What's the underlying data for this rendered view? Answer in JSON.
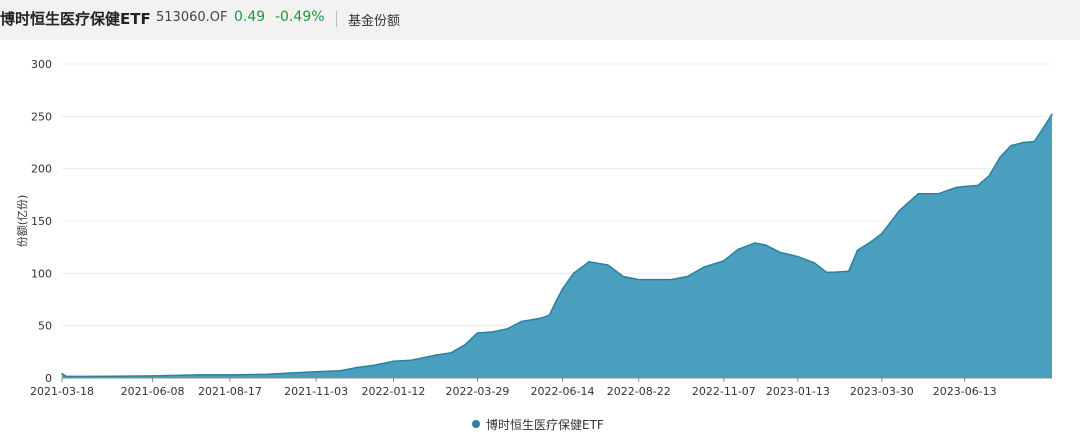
{
  "header": {
    "fund_name": "博时恒生医疗保健ETF",
    "fund_code": "513060.OF",
    "price": "0.49",
    "change": "-0.49%",
    "metric_label": "基金份额"
  },
  "colors": {
    "area": "#4a9fbf",
    "line": "#2e7f9f",
    "legend_dot": "#2e7f9f",
    "grid": "#ececec",
    "up_down": "#1a9a3a"
  },
  "chart_data": {
    "type": "area",
    "ylabel": "份额(亿份)",
    "ylim": [
      0,
      300
    ],
    "yticks": [
      0,
      50,
      100,
      150,
      200,
      250,
      300
    ],
    "xticks": [
      "2021-03-18",
      "2021-06-08",
      "2021-08-17",
      "2021-11-03",
      "2022-01-12",
      "2022-03-29",
      "2022-06-14",
      "2022-08-22",
      "2022-11-07",
      "2023-01-13",
      "2023-03-30",
      "2023-06-13"
    ],
    "x_range": [
      "2021-03-18",
      "2023-08-31"
    ],
    "grid": true,
    "legend_position": "bottom-center",
    "series": [
      {
        "name": "博时恒生医疗保健ETF",
        "x": [
          "2021-03-18",
          "2021-03-22",
          "2021-04-15",
          "2021-06-08",
          "2021-07-20",
          "2021-08-17",
          "2021-09-20",
          "2021-10-15",
          "2021-11-03",
          "2021-11-25",
          "2021-12-10",
          "2021-12-25",
          "2022-01-12",
          "2022-01-28",
          "2022-02-20",
          "2022-03-05",
          "2022-03-18",
          "2022-03-29",
          "2022-04-12",
          "2022-04-25",
          "2022-05-08",
          "2022-05-25",
          "2022-06-02",
          "2022-06-08",
          "2022-06-14",
          "2022-06-24",
          "2022-07-08",
          "2022-07-25",
          "2022-08-08",
          "2022-08-22",
          "2022-09-05",
          "2022-09-20",
          "2022-10-05",
          "2022-10-20",
          "2022-11-07",
          "2022-11-20",
          "2022-12-05",
          "2022-12-15",
          "2022-12-28",
          "2023-01-13",
          "2023-01-28",
          "2023-02-08",
          "2023-02-15",
          "2023-02-28",
          "2023-03-08",
          "2023-03-20",
          "2023-03-30",
          "2023-04-15",
          "2023-05-02",
          "2023-05-20",
          "2023-06-05",
          "2023-06-13",
          "2023-06-25",
          "2023-07-05",
          "2023-07-15",
          "2023-07-25",
          "2023-08-05",
          "2023-08-15",
          "2023-08-25",
          "2023-08-31"
        ],
        "values": [
          4,
          1.5,
          1.5,
          2,
          3,
          3,
          3.5,
          5,
          6,
          7,
          10,
          12,
          16,
          17,
          22,
          24,
          32,
          43,
          44,
          47,
          54,
          57,
          60,
          73,
          85,
          100,
          111,
          108,
          97,
          94,
          94,
          94,
          97,
          106,
          112,
          123,
          129,
          127,
          120,
          116,
          110,
          101,
          101,
          102,
          122,
          130,
          138,
          160,
          176,
          176,
          182,
          183,
          184,
          193,
          211,
          222,
          225,
          226,
          242,
          252
        ]
      }
    ]
  }
}
